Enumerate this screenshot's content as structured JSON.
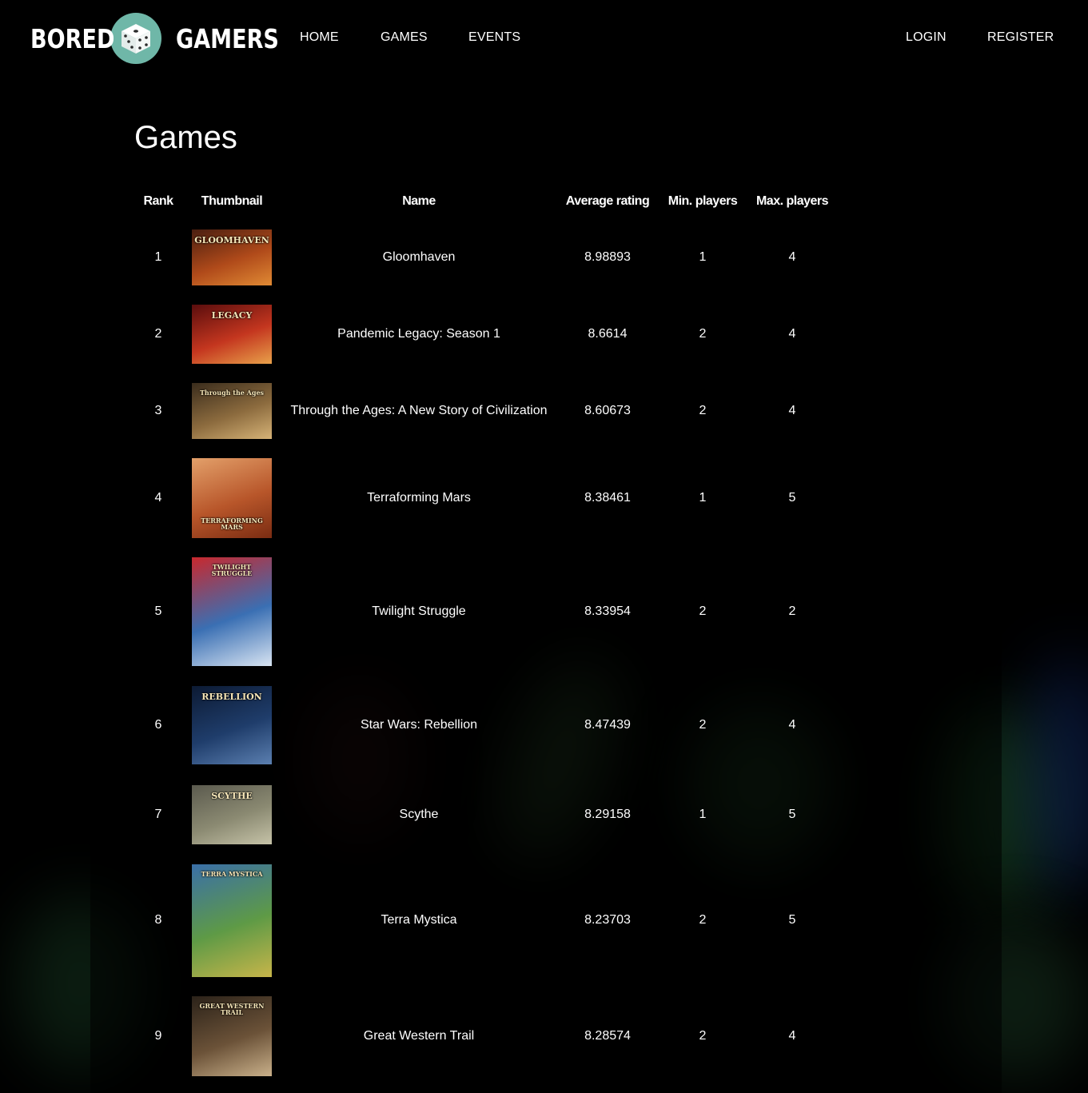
{
  "brand": {
    "left_word": "BORED",
    "right_word": "GAMERS",
    "accent": "#6fb7a8"
  },
  "nav": {
    "home": "HOME",
    "games": "GAMES",
    "events": "EVENTS",
    "login": "LOGIN",
    "register": "REGISTER"
  },
  "page": {
    "title": "Games"
  },
  "table": {
    "headers": {
      "rank": "Rank",
      "thumbnail": "Thumbnail",
      "name": "Name",
      "avg": "Average rating",
      "min": "Min. players",
      "max": "Max. players"
    },
    "rows": [
      {
        "rank": "1",
        "name": "Gloomhaven",
        "avg": "8.98893",
        "min": "1",
        "max": "4",
        "thumb_text": "GLOOMHAVEN",
        "colors": [
          "#4a1e10",
          "#b04a1a",
          "#e08a34"
        ]
      },
      {
        "rank": "2",
        "name": "Pandemic Legacy: Season 1",
        "avg": "8.6614",
        "min": "2",
        "max": "4",
        "thumb_text": "LEGACY",
        "colors": [
          "#5a0d0d",
          "#c4361f",
          "#e8a14a"
        ]
      },
      {
        "rank": "3",
        "name": "Through the Ages: A New Story of Civilization",
        "avg": "8.60673",
        "min": "2",
        "max": "4",
        "thumb_text": "Through the Ages",
        "colors": [
          "#3a2c1c",
          "#8c6b3e",
          "#d6b377"
        ]
      },
      {
        "rank": "4",
        "name": "Terraforming Mars",
        "avg": "8.38461",
        "min": "1",
        "max": "5",
        "thumb_text": "TERRAFORMING MARS",
        "colors": [
          "#e3a06a",
          "#b8562a",
          "#7a2c12"
        ]
      },
      {
        "rank": "5",
        "name": "Twilight Struggle",
        "avg": "8.33954",
        "min": "2",
        "max": "2",
        "thumb_text": "TWILIGHT STRUGGLE",
        "colors": [
          "#c9282d",
          "#3a6fb3",
          "#d8e4f2"
        ]
      },
      {
        "rank": "6",
        "name": "Star Wars: Rebellion",
        "avg": "8.47439",
        "min": "2",
        "max": "4",
        "thumb_text": "REBELLION",
        "colors": [
          "#0c1a33",
          "#1f3d6b",
          "#5b7fb0"
        ]
      },
      {
        "rank": "7",
        "name": "Scythe",
        "avg": "8.29158",
        "min": "1",
        "max": "5",
        "thumb_text": "SCYTHE",
        "colors": [
          "#5b5a4e",
          "#8b8a72",
          "#c6c3a8"
        ]
      },
      {
        "rank": "8",
        "name": "Terra Mystica",
        "avg": "8.23703",
        "min": "2",
        "max": "5",
        "thumb_text": "TERRA MYSTICA",
        "colors": [
          "#3a6fa8",
          "#5e9a46",
          "#c7b54a"
        ]
      },
      {
        "rank": "9",
        "name": "Great Western Trail",
        "avg": "8.28574",
        "min": "2",
        "max": "4",
        "thumb_text": "GREAT WESTERN TRAIL",
        "colors": [
          "#2b2219",
          "#6b5238",
          "#c9b08a"
        ]
      }
    ]
  }
}
